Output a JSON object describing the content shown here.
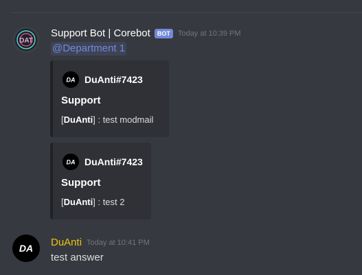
{
  "colors": {
    "background": "#36393f",
    "embed_bg": "#2f3136",
    "bot_tag": "#7289da",
    "mention": "#7289da",
    "duanti_name": "#f1c40f"
  },
  "messages": [
    {
      "author": "Support Bot | Corebot",
      "bot_tag": "BOT",
      "timestamp": "Today at 10:39 PM",
      "avatar_icon": "corebot-avatar-icon",
      "mention": "@Department 1",
      "embeds": [
        {
          "author_name": "DuAnti#7423",
          "author_icon": "duanti-logo-icon",
          "title": "Support",
          "desc_open": "[",
          "desc_bold": "DuAnti",
          "desc_close": "]",
          "desc_text": " : test modmail"
        },
        {
          "author_name": "DuAnti#7423",
          "author_icon": "duanti-logo-icon",
          "title": "Support",
          "desc_open": "[",
          "desc_bold": "DuAnti",
          "desc_close": "]",
          "desc_text": " : test 2"
        }
      ]
    },
    {
      "author": "DuAnti",
      "timestamp": "Today at 10:41 PM",
      "avatar_icon": "duanti-avatar-icon",
      "text": "test answer"
    }
  ]
}
